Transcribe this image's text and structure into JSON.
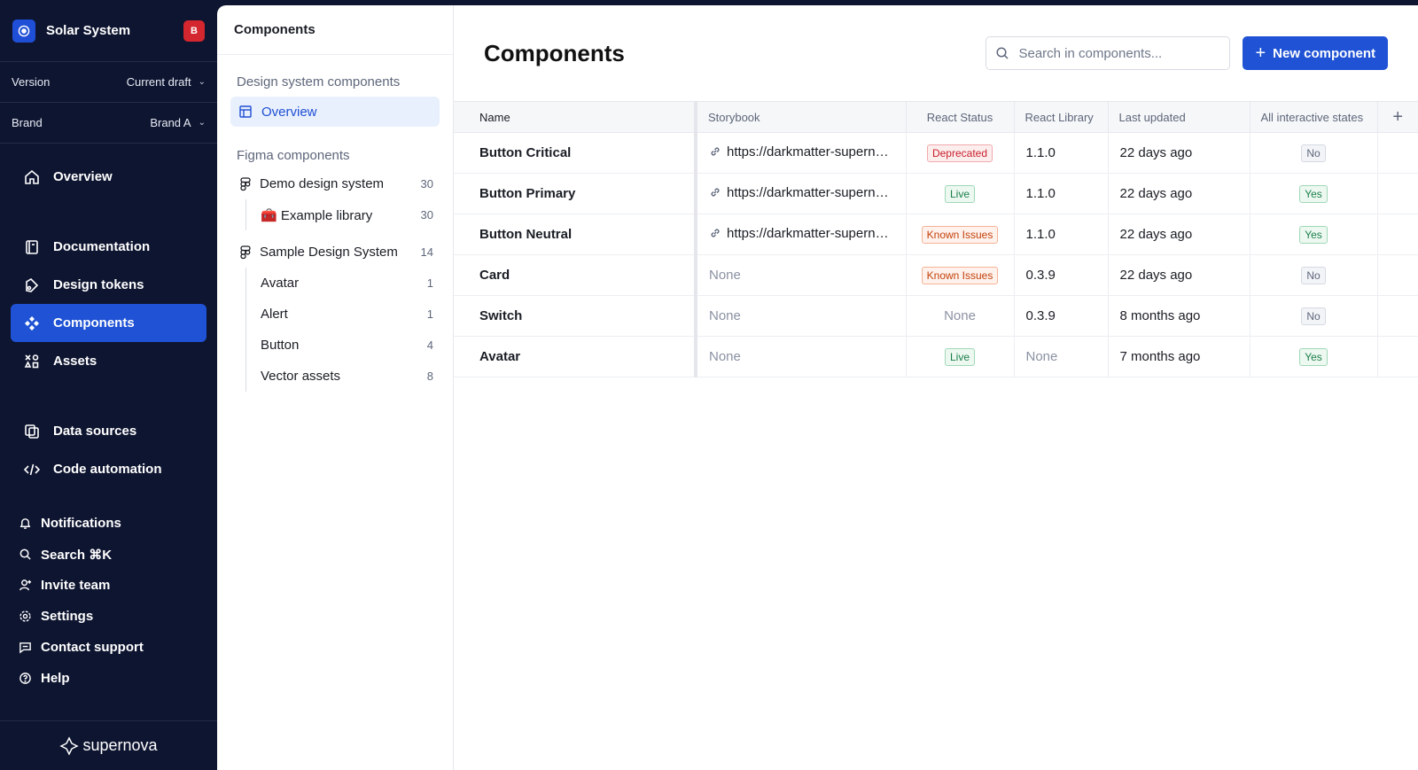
{
  "workspace": {
    "name": "Solar System",
    "user_initial": "B"
  },
  "version": {
    "label": "Version",
    "value": "Current draft"
  },
  "brand": {
    "label": "Brand",
    "value": "Brand A"
  },
  "nav": {
    "overview": "Overview",
    "documentation": "Documentation",
    "design_tokens": "Design tokens",
    "components": "Components",
    "assets": "Assets",
    "data_sources": "Data sources",
    "code_automation": "Code automation",
    "notifications": "Notifications",
    "search": "Search ⌘K",
    "invite_team": "Invite team",
    "settings": "Settings",
    "contact_support": "Contact support",
    "help": "Help",
    "footer_logo": "supernova"
  },
  "panel": {
    "title": "Components",
    "ds_section": "Design system components",
    "overview": "Overview",
    "figma_section": "Figma components",
    "tree": [
      {
        "label": "Demo design system",
        "count": "30"
      },
      {
        "label": "🧰 Example library",
        "count": "30"
      },
      {
        "label": "Sample Design System",
        "count": "14"
      },
      {
        "label": "Avatar",
        "count": "1"
      },
      {
        "label": "Alert",
        "count": "1"
      },
      {
        "label": "Button",
        "count": "4"
      },
      {
        "label": "Vector assets",
        "count": "8"
      }
    ]
  },
  "main": {
    "title": "Components",
    "search_placeholder": "Search in components...",
    "new_button": "New component",
    "columns": [
      "Name",
      "Storybook",
      "React Status",
      "React Library",
      "Last updated",
      "All interactive states",
      "+"
    ],
    "rows": [
      {
        "name": "Button Critical",
        "storybook": "https://darkmatter-supernova.io",
        "status": "Deprecated",
        "version": "1.1.0",
        "updated": "22 days ago",
        "states": "No"
      },
      {
        "name": "Button Primary",
        "storybook": "https://darkmatter-supernova.io",
        "status": "Live",
        "version": "1.1.0",
        "updated": "22 days ago",
        "states": "Yes"
      },
      {
        "name": "Button Neutral",
        "storybook": "https://darkmatter-supernova.io",
        "status": "Known Issues",
        "version": "1.1.0",
        "updated": "22 days ago",
        "states": "Yes"
      },
      {
        "name": "Card",
        "storybook": "None",
        "status": "Known Issues",
        "version": "0.3.9",
        "updated": "22 days ago",
        "states": "No"
      },
      {
        "name": "Switch",
        "storybook": "None",
        "status": "None",
        "version": "0.3.9",
        "updated": "8 months ago",
        "states": "No"
      },
      {
        "name": "Avatar",
        "storybook": "None",
        "status": "Live",
        "version": "None",
        "updated": "7 months ago",
        "states": "Yes"
      }
    ]
  },
  "colors": {
    "nav_bg": "#0e1530",
    "accent": "#1f52d4",
    "badge": "#d3262f"
  }
}
